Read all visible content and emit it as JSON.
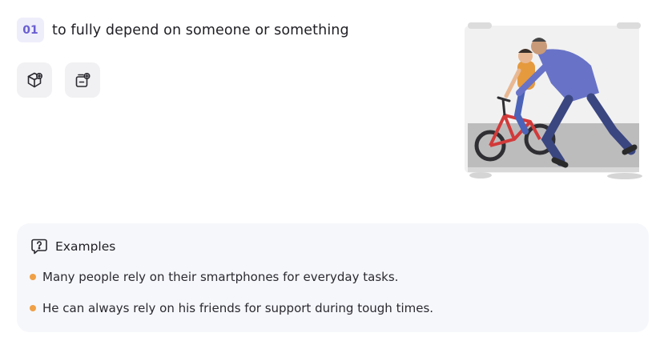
{
  "definition": {
    "number": "01",
    "text": "to fully depend on someone or something"
  },
  "actions": [
    {
      "icon": "cube-plus-icon"
    },
    {
      "icon": "card-plus-icon"
    }
  ],
  "illustration": {
    "subject": "man teaching child to ride red bicycle",
    "colors": {
      "bike": "#d23a3a",
      "shirt": "#6873c7",
      "child_shirt": "#e59a3e",
      "ground": "#bdbcbc"
    }
  },
  "examples": {
    "title": "Examples",
    "items": [
      "Many people rely on their smartphones for everyday tasks.",
      "He can always rely on his friends for support during tough times."
    ]
  },
  "colors": {
    "accent": "#6a5fd1",
    "bullet": "#f0a046",
    "card_bg": "#f6f7fb"
  }
}
